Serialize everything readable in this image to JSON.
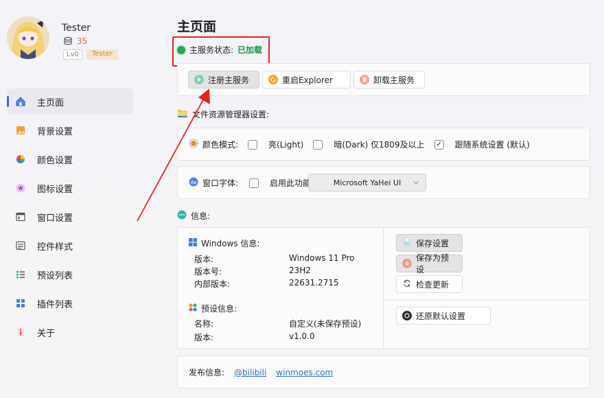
{
  "user": {
    "name": "Tester",
    "coins": "35",
    "level": "Lv0",
    "role": "Tester"
  },
  "sidebar": {
    "items": [
      {
        "label": "主页面",
        "icon": "home-icon",
        "active": true
      },
      {
        "label": "背景设置",
        "icon": "image-icon"
      },
      {
        "label": "颜色设置",
        "icon": "palette-icon"
      },
      {
        "label": "图标设置",
        "icon": "star-icon"
      },
      {
        "label": "窗口设置",
        "icon": "window-icon"
      },
      {
        "label": "控件样式",
        "icon": "controls-icon"
      },
      {
        "label": "预设列表",
        "icon": "list-icon"
      },
      {
        "label": "插件列表",
        "icon": "plugin-icon"
      },
      {
        "label": "关于",
        "icon": "info-icon"
      }
    ]
  },
  "main": {
    "title": "主页面",
    "status_label": "主服务状态:",
    "status_value": "已加载",
    "buttons": {
      "register": "注册主服务",
      "restart": "重启Explorer",
      "uninstall": "卸载主服务"
    },
    "explorer_heading": "文件资源管理器设置:",
    "color_mode": {
      "label": "颜色模式:",
      "light": "亮(Light)",
      "dark": "暗(Dark) 仅1809及以上",
      "system": "跟随系统设置 (默认)",
      "system_checked": true
    },
    "font": {
      "label": "窗口字体:",
      "enable": "启用此功能",
      "selected": "Microsoft YaHei UI"
    },
    "info_heading": "信息:",
    "windows": {
      "heading": "Windows 信息:",
      "rows": [
        {
          "k": "版本:",
          "v": "Windows 11 Pro"
        },
        {
          "k": "版本号:",
          "v": "23H2"
        },
        {
          "k": "内部版本:",
          "v": "22631.2715"
        }
      ]
    },
    "preset": {
      "heading": "预设信息:",
      "rows": [
        {
          "k": "名称:",
          "v": "自定义(未保存预设)"
        },
        {
          "k": "版本:",
          "v": "v1.0.0"
        }
      ]
    },
    "actions": {
      "save": "保存设置",
      "save_preset": "保存为预设",
      "check_update": "检查更新",
      "restore": "还原默认设置"
    },
    "release": {
      "label": "发布信息:",
      "link1": "@bilibili",
      "link2": "winmoes.com"
    }
  },
  "colors": {
    "accent": "#3b6bd6",
    "status_green": "#1d9446",
    "highlight_red": "#e8231f"
  }
}
